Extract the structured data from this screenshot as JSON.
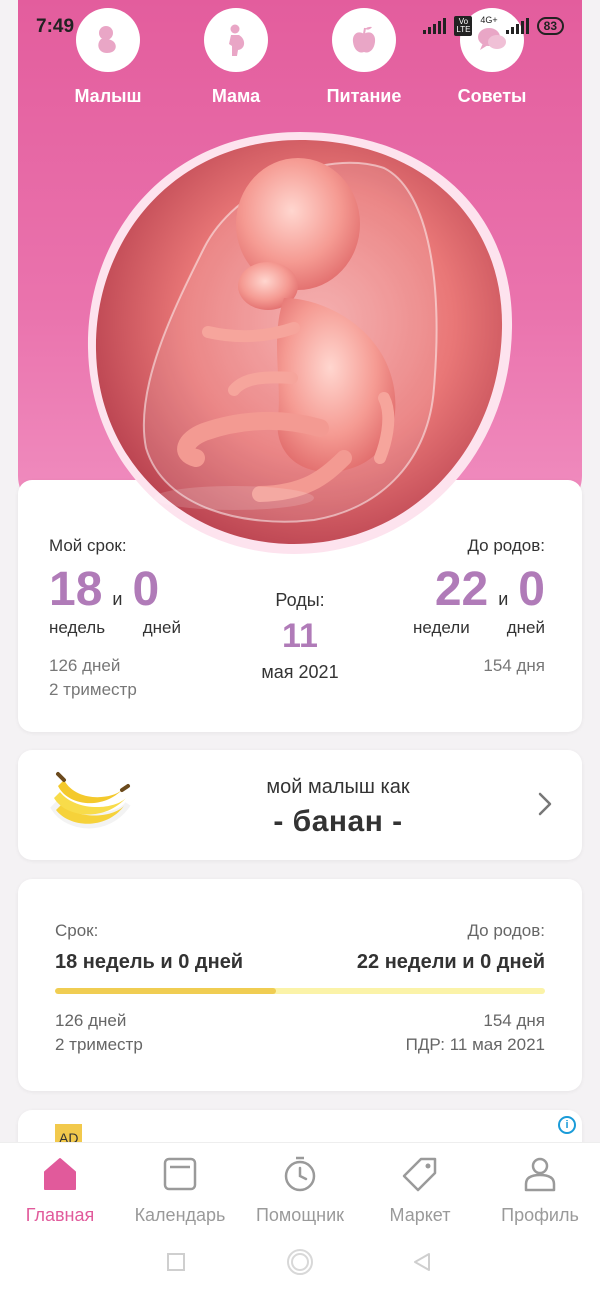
{
  "status": {
    "time": "7:49",
    "network": "4G+",
    "volte": "Vo LTE",
    "battery": "83"
  },
  "top_nav": [
    {
      "label": "Малыш",
      "icon": "baby-icon"
    },
    {
      "label": "Мама",
      "icon": "pregnant-woman-icon"
    },
    {
      "label": "Питание",
      "icon": "apple-icon"
    },
    {
      "label": "Советы",
      "icon": "chat-bubbles-icon"
    }
  ],
  "term": {
    "my_term_label": "Мой срок:",
    "weeks": "18",
    "and1": "и",
    "days": "0",
    "weeks_unit": "недель",
    "days_unit": "дней",
    "total_days": "126 дней",
    "trimester": "2 триместр",
    "birth_label": "Роды:",
    "birth_day": "11",
    "birth_month": "мая 2021",
    "to_birth_label": "До родов:",
    "rem_weeks": "22",
    "and2": "и",
    "rem_days": "0",
    "rem_weeks_unit": "недели",
    "rem_days_unit": "дней",
    "rem_total_days": "154 дня"
  },
  "fruit": {
    "line1": "мой малыш как",
    "line2": "- банан -",
    "icon": "banana-icon"
  },
  "progress": {
    "term_label": "Срок:",
    "to_birth_label": "До родов:",
    "term_value": "18 недель и 0 дней",
    "to_birth_value": "22 недели и 0 дней",
    "fraction": 0.45,
    "days": "126 дней",
    "trimester": "2 триместр",
    "rem_days": "154 дня",
    "due_date": "ПДР: 11 мая 2021"
  },
  "ad": {
    "badge": "AD",
    "info": "i"
  },
  "bottom_nav": [
    {
      "label": "Главная",
      "icon": "home-icon",
      "active": true
    },
    {
      "label": "Календарь",
      "icon": "calendar-icon",
      "active": false
    },
    {
      "label": "Помощник",
      "icon": "stopwatch-icon",
      "active": false
    },
    {
      "label": "Маркет",
      "icon": "tag-icon",
      "active": false
    },
    {
      "label": "Профиль",
      "icon": "profile-icon",
      "active": false
    }
  ],
  "colors": {
    "accent": "#e15a9b",
    "number": "#b07bb8",
    "progress_fill": "#f0cd52",
    "progress_track": "#fbf3a8"
  }
}
